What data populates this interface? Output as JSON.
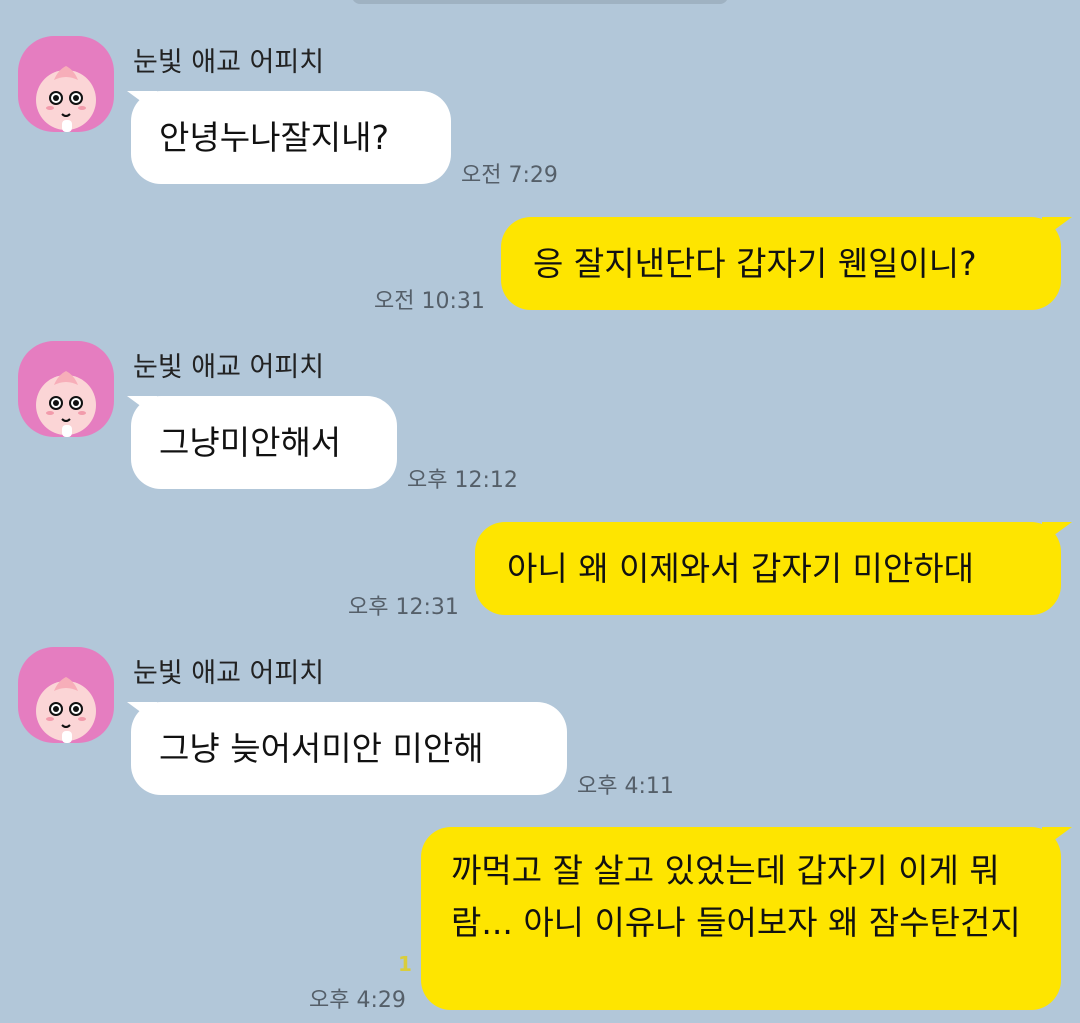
{
  "messages": [
    {
      "direction": "incoming",
      "sender": "눈빛 애교 어피치",
      "text": "안녕누나잘지내?",
      "time": "오전 7:29"
    },
    {
      "direction": "outgoing",
      "text": "응 잘지낸단다 갑자기 웬일이니?",
      "time": "오전 10:31"
    },
    {
      "direction": "incoming",
      "sender": "눈빛 애교 어피치",
      "text": "그냥미안해서",
      "time": "오후 12:12"
    },
    {
      "direction": "outgoing",
      "text": "아니 왜 이제와서 갑자기 미안하대",
      "time": "오후 12:31"
    },
    {
      "direction": "incoming",
      "sender": "눈빛 애교 어피치",
      "text": "그냥 늦어서미안 미안해",
      "time": "오후 4:11"
    },
    {
      "direction": "outgoing",
      "text": "까먹고 잘 살고 있었는데 갑자기 이게 뭐람... 아니 이유나 들어보자 왜 잠수탄건지",
      "time": "오후 4:29",
      "unread_count": "1"
    }
  ],
  "colors": {
    "background": "#b2c7d9",
    "incoming_bubble": "#ffffff",
    "outgoing_bubble": "#fee500",
    "avatar_bg": "#e57dc0",
    "time_text": "#555f69",
    "unread_text": "#d9cd3c"
  },
  "icons": {
    "avatar": "apeach-character-avatar"
  }
}
